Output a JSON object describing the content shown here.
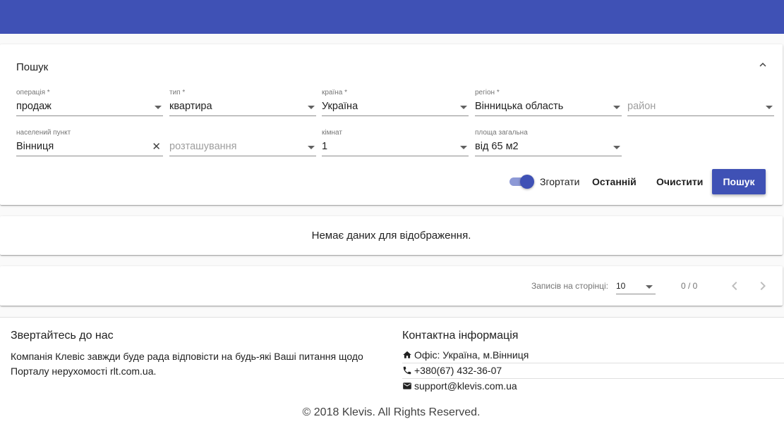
{
  "colors": {
    "primary": "#3f51b5",
    "toggle_track": "#8d99d6"
  },
  "search": {
    "title": "Пошук",
    "collapse_icon": "chevron-up-icon",
    "fields": {
      "operation": {
        "label": "операція *",
        "value": "продаж"
      },
      "type": {
        "label": "тип *",
        "value": "квартира"
      },
      "country": {
        "label": "країна *",
        "value": "Україна"
      },
      "region": {
        "label": "регіон *",
        "value": "Вінницька область"
      },
      "district": {
        "placeholder": "район"
      },
      "locality": {
        "label": "населений пункт",
        "value": "Вінниця"
      },
      "location": {
        "placeholder": "розташування"
      },
      "rooms": {
        "label": "кімнат",
        "value": "1"
      },
      "area": {
        "label": "площа загальна",
        "value": "від 65 м2"
      }
    },
    "collapse_toggle": {
      "label": "Згортати",
      "on": true
    },
    "last_button": "Останній",
    "clear_button": "Очистити",
    "search_button": "Пошук"
  },
  "results": {
    "empty_message": "Немає даних для відображення."
  },
  "pagination": {
    "per_page_label": "Записів на сторінці:",
    "per_page_value": "10",
    "range": "0 / 0",
    "prev_icon": "chevron-left-icon",
    "next_icon": "chevron-right-icon"
  },
  "footer": {
    "contact_us_title": "Звертайтесь до нас",
    "about_text": "Компанія Клевіс завжди буде рада відповісти на будь-які Ваші питання щодо Порталу нерухомості rlt.com.ua.",
    "contact_info_title": "Контактна інформація",
    "office": {
      "icon": "home-icon",
      "text": "Офіс: Україна, м.Вінниця"
    },
    "phone": {
      "icon": "phone-icon",
      "text": "+380(67) 432-36-07"
    },
    "email": {
      "icon": "envelope-icon",
      "text": "support@klevis.com.ua"
    },
    "copyright": "© 2018 Klevis. All Rights Reserved."
  }
}
